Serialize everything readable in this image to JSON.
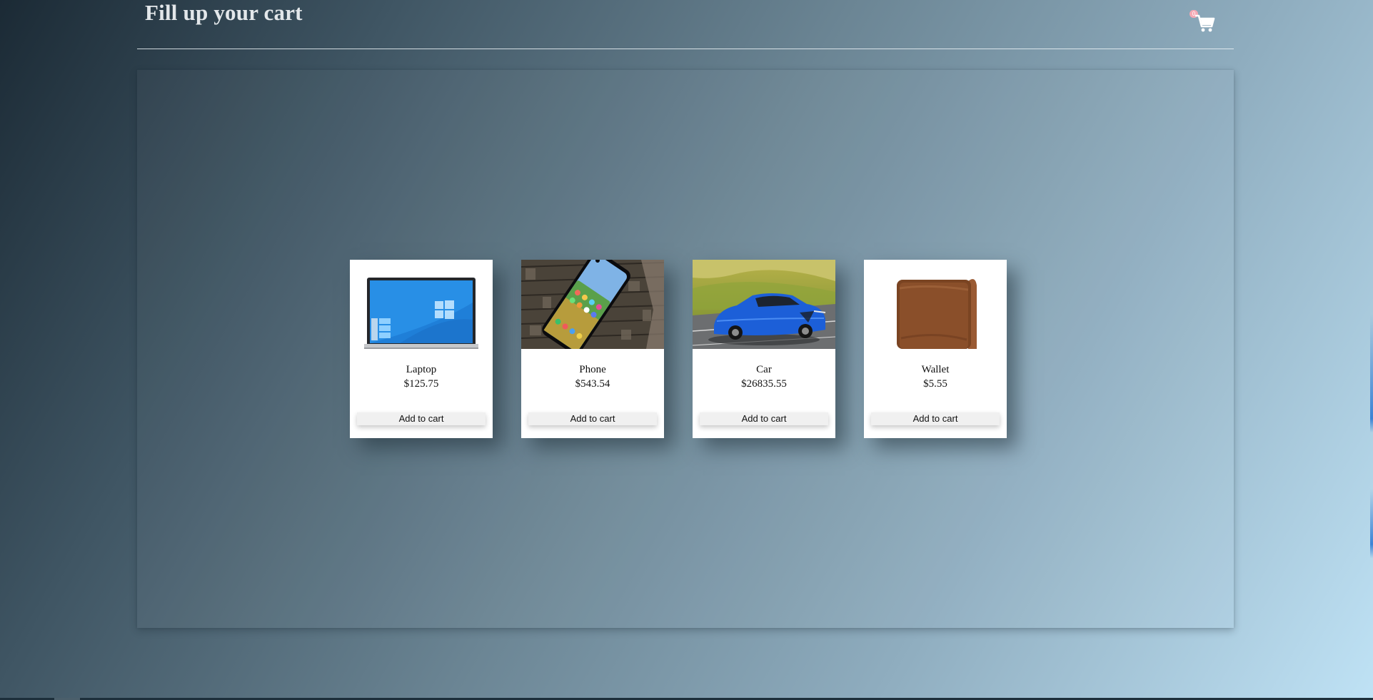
{
  "header": {
    "title": "Fill up your cart",
    "cart": {
      "count": "0",
      "icon": "shopping-cart-icon",
      "badge_color": "#f5a9b4"
    }
  },
  "products": [
    {
      "name": "Laptop",
      "price": "$125.75",
      "button": "Add to cart",
      "image": "laptop-image"
    },
    {
      "name": "Phone",
      "price": "$543.54",
      "button": "Add to cart",
      "image": "phone-image"
    },
    {
      "name": "Car",
      "price": "$26835.55",
      "button": "Add to cart",
      "image": "car-image"
    },
    {
      "name": "Wallet",
      "price": "$5.55",
      "button": "Add to cart",
      "image": "wallet-image"
    }
  ],
  "colors": {
    "title_text": "#e3e7ea",
    "card_background": "#ffffff",
    "button_background": "#f0f0f0"
  }
}
